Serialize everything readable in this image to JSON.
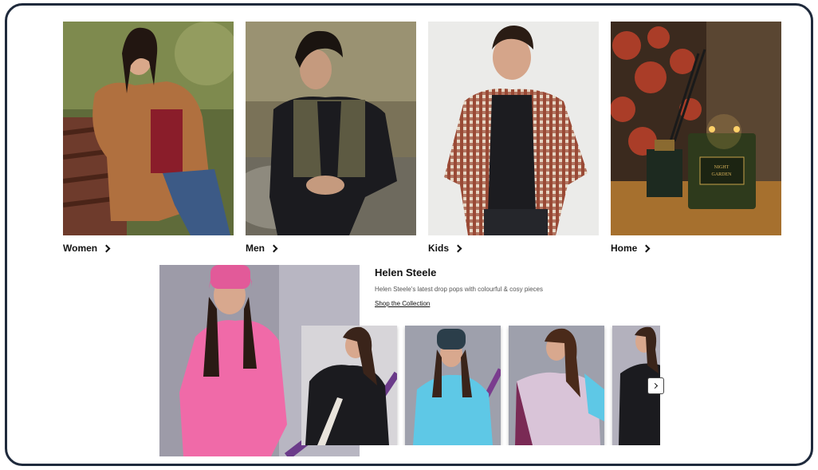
{
  "categories": [
    {
      "label": "Women",
      "image": "woman-in-brown-jacket-on-bench"
    },
    {
      "label": "Men",
      "image": "man-in-quilted-vest-sitting-on-rock"
    },
    {
      "label": "Kids",
      "image": "boy-in-checked-shirt"
    },
    {
      "label": "Home",
      "image": "candles-and-reed-diffuser"
    }
  ],
  "feature": {
    "title": "Helen Steele",
    "subtitle": "Helen Steele's latest drop pops with colourful & cosy pieces",
    "link": "Shop the Collection",
    "candle_text": "NIGHT GARDEN"
  },
  "colors": {
    "frame_border": "#1f2a3c",
    "text": "#111111",
    "pink_hoodie": "#f06aa8",
    "blue_hoodie": "#5ec8e6"
  },
  "icons": {
    "category_arrow": "chevron-right-icon",
    "carousel_next": "chevron-right-icon"
  }
}
